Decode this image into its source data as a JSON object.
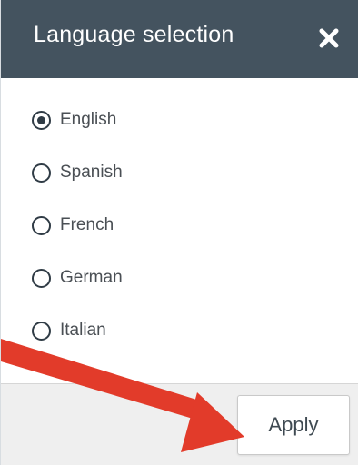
{
  "dialog": {
    "title": "Language selection",
    "close_icon": "close-icon",
    "apply_label": "Apply"
  },
  "languages": {
    "options": [
      {
        "label": "English",
        "checked": true
      },
      {
        "label": "Spanish",
        "checked": false
      },
      {
        "label": "French",
        "checked": false
      },
      {
        "label": "German",
        "checked": false
      },
      {
        "label": "Italian",
        "checked": false
      }
    ]
  },
  "annotation": {
    "arrow_icon": "red-pointer-arrow-icon",
    "arrow_color": "#e23b2a"
  },
  "colors": {
    "header_bg": "#44535f",
    "footer_bg": "#efefef"
  }
}
